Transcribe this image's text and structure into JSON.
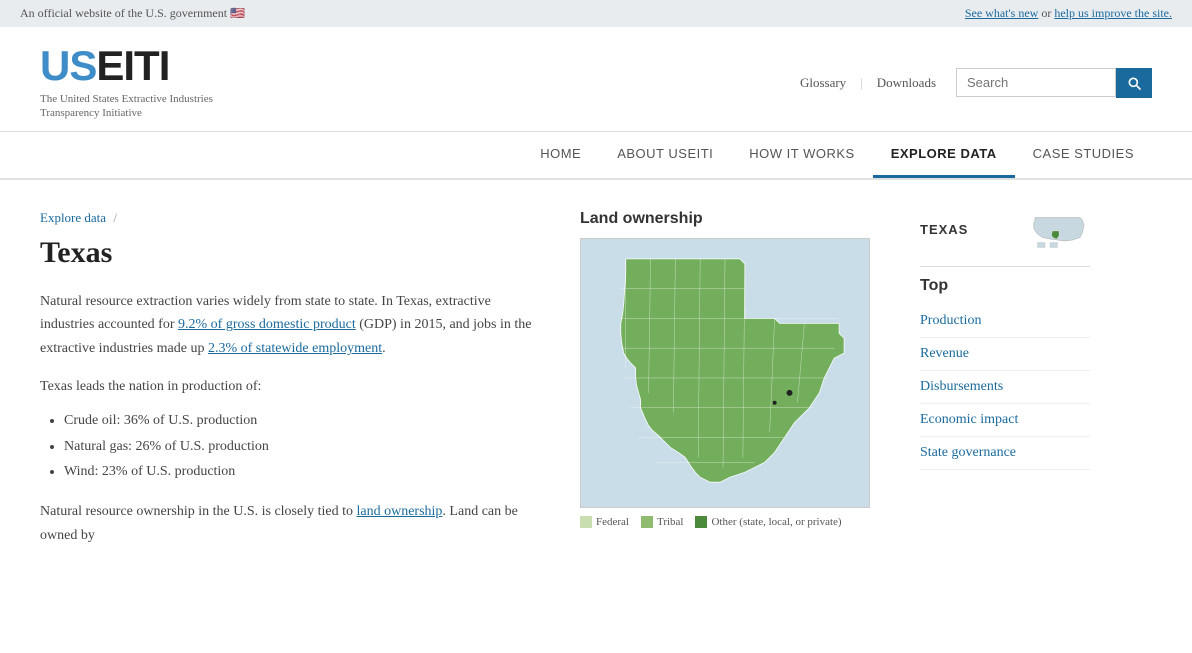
{
  "topbar": {
    "official_text": "An official website of the U.S. government",
    "flag_emoji": "🇺🇸",
    "see_whats_new": "See what's new",
    "or_text": "or",
    "help_link": "help us improve the site."
  },
  "header": {
    "logo_us": "US",
    "logo_eiti": "EITI",
    "logo_subtitle_line1": "The United States Extractive Industries",
    "logo_subtitle_line2": "Transparency Initiative",
    "glossary_label": "Glossary",
    "downloads_label": "Downloads",
    "search_placeholder": "Search"
  },
  "nav": {
    "items": [
      {
        "label": "HOME",
        "key": "home"
      },
      {
        "label": "ABOUT USEITI",
        "key": "about"
      },
      {
        "label": "HOW IT WORKS",
        "key": "how"
      },
      {
        "label": "EXPLORE DATA",
        "key": "explore",
        "active": true
      },
      {
        "label": "CASE STUDIES",
        "key": "case"
      }
    ]
  },
  "breadcrumb": {
    "parent": "Explore data",
    "separator": "/"
  },
  "page": {
    "title": "Texas",
    "intro_text": "Natural resource extraction varies widely from state to state. In Texas, extractive industries accounted for ",
    "gdp_link": "9.2% of gross domestic product",
    "gdp_after": " (GDP) in 2015, and jobs in the extractive industries made up ",
    "employment_link": "2.3% of statewide employment",
    "employment_after": ".",
    "lead_text": "Texas leads the nation in production of:",
    "bullets": [
      "Crude oil: 36% of U.S. production",
      "Natural gas: 26% of U.S. production",
      "Wind: 23% of U.S. production"
    ],
    "bottom_text_part1": "Natural resource ownership in the U.S. is closely tied to ",
    "land_link": "land ownership",
    "bottom_text_part2": ". Land can be owned by"
  },
  "map": {
    "title": "Land ownership",
    "legend": [
      {
        "label": "Federal",
        "color": "#c8ddb0"
      },
      {
        "label": "Tribal",
        "color": "#8fbb6e"
      },
      {
        "label": "Other (state, local, or private)",
        "color": "#4a8a3a"
      }
    ]
  },
  "sidebar": {
    "state_label": "TEXAS",
    "section_title": "Top",
    "links": [
      {
        "label": "Production"
      },
      {
        "label": "Revenue"
      },
      {
        "label": "Disbursements"
      },
      {
        "label": "Economic impact"
      },
      {
        "label": "State governance"
      }
    ]
  }
}
